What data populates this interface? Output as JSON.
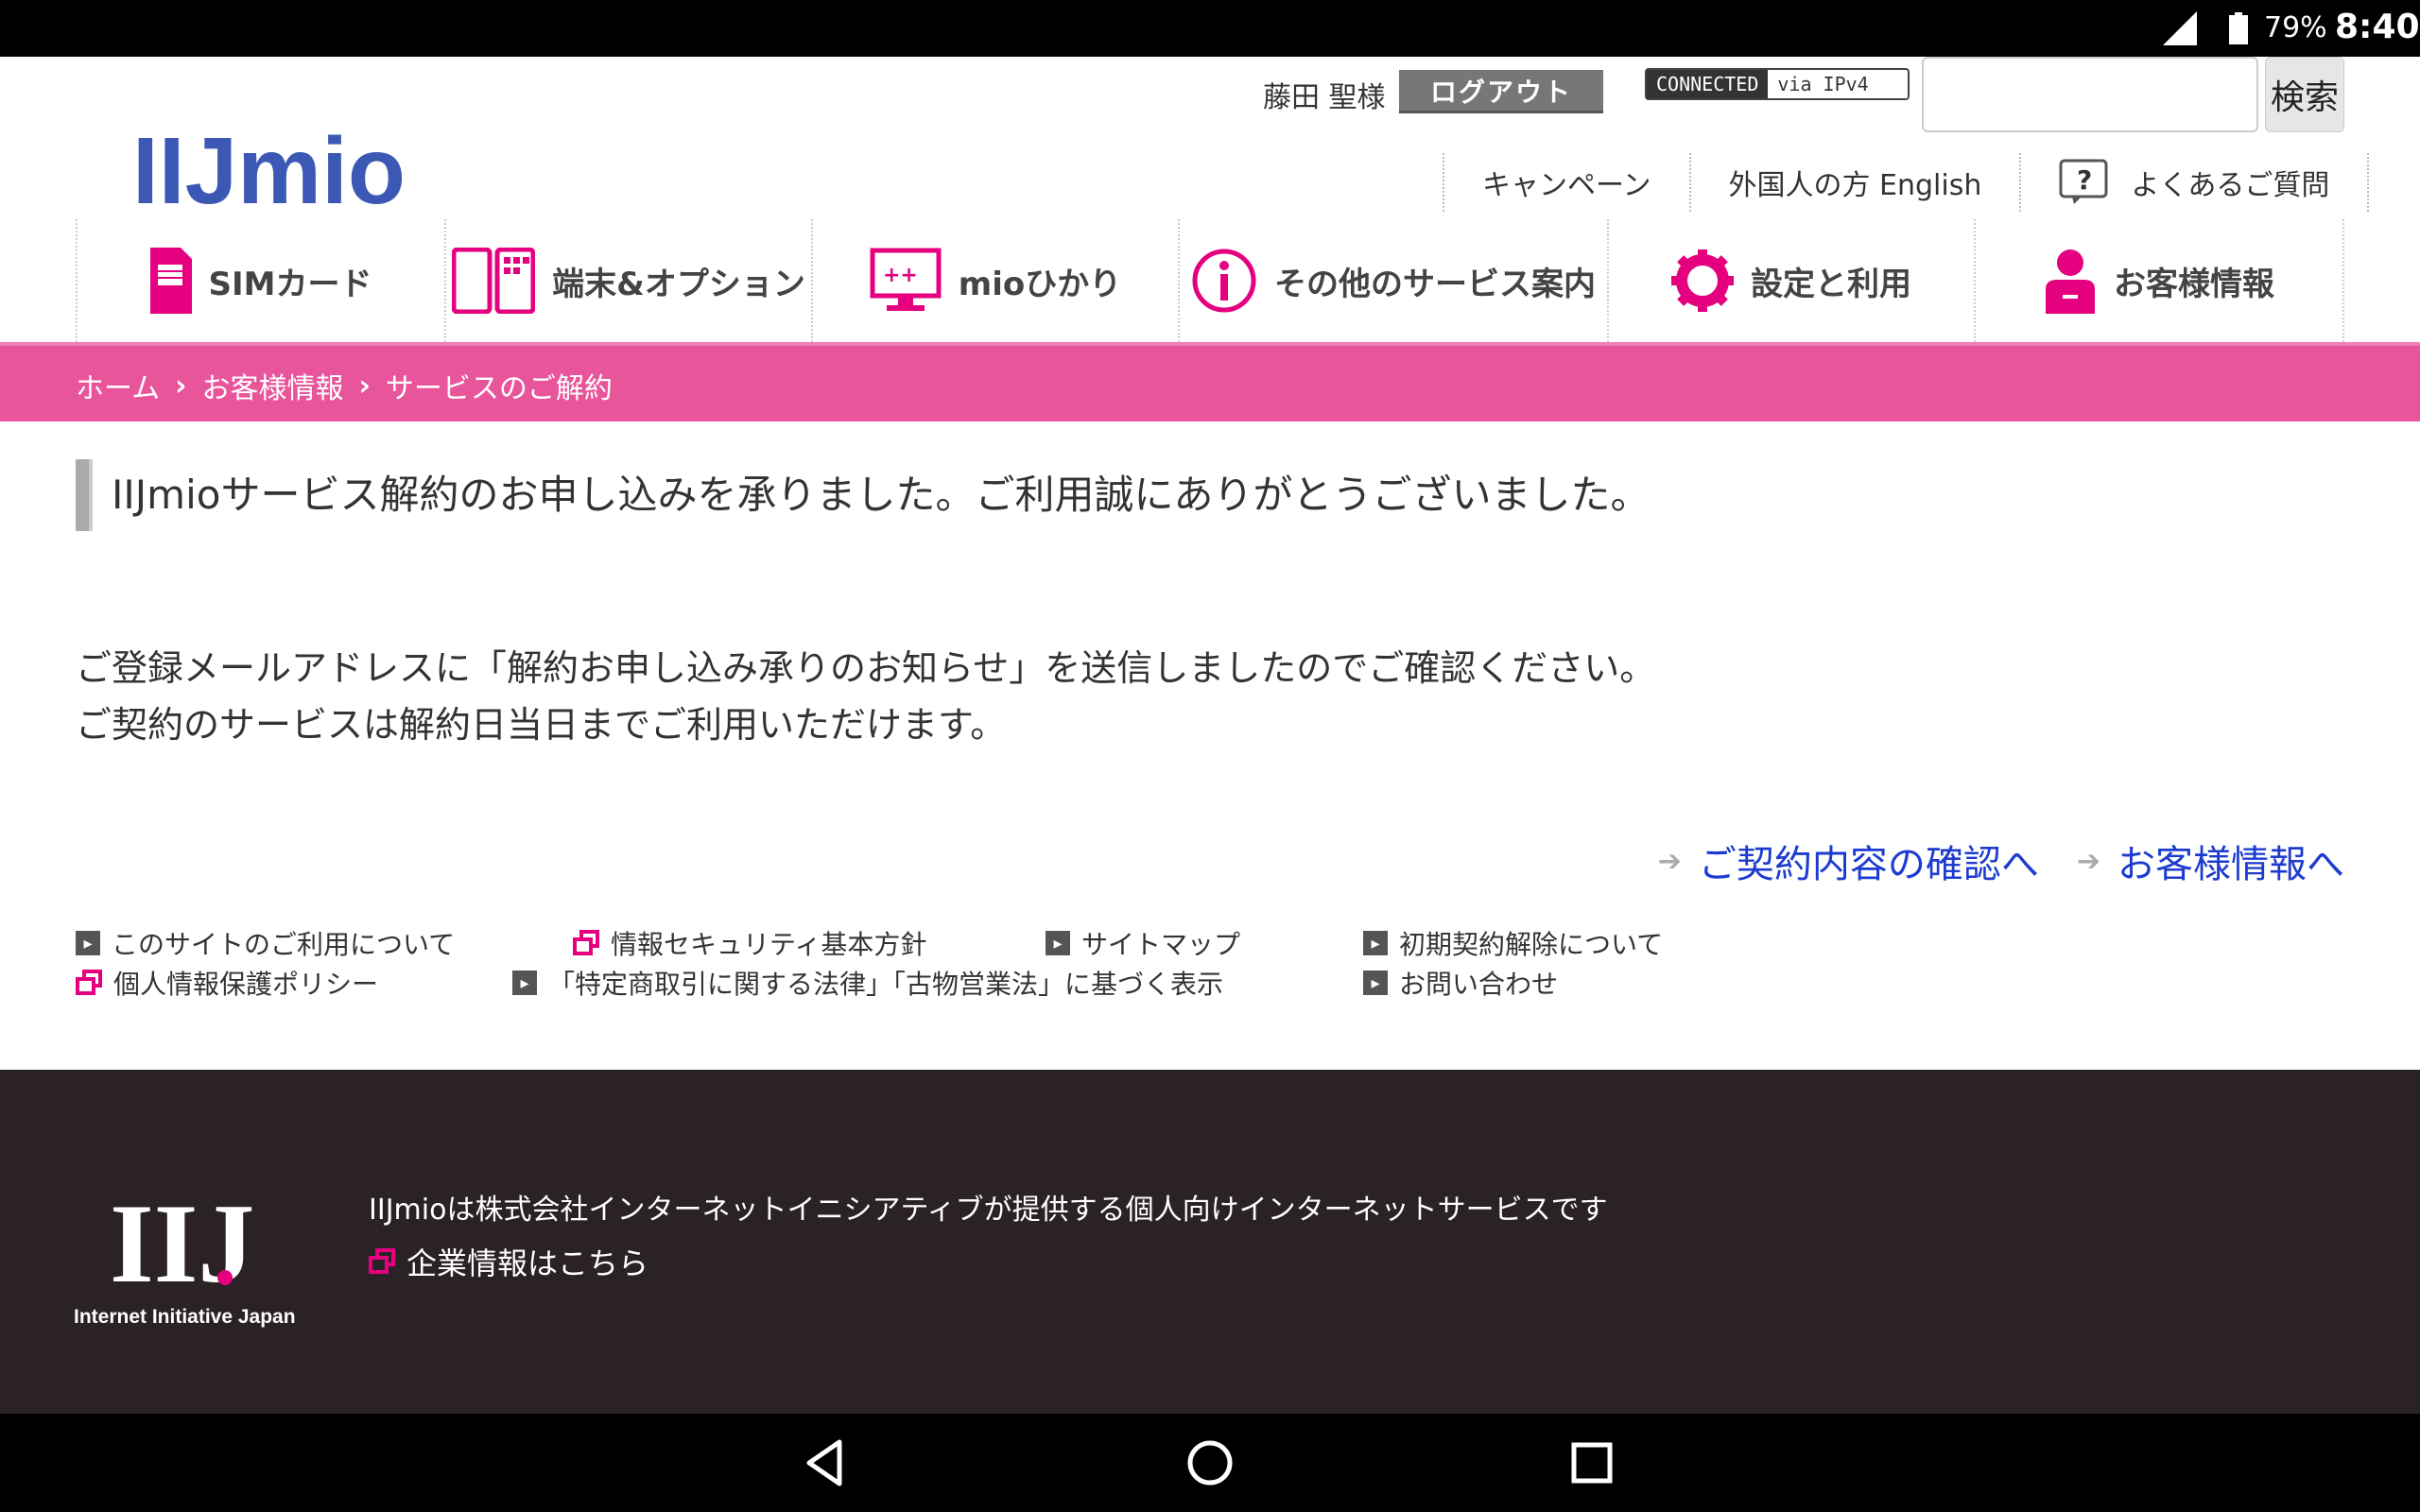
{
  "status_bar": {
    "network": "4G",
    "battery": "79%",
    "time": "8:40"
  },
  "header": {
    "logo_text": "IIJmio",
    "username": "藤田 聖様",
    "logout_label": "ログアウト",
    "connected_label": "CONNECTED",
    "connected_via": "via IPv4",
    "search_placeholder": "",
    "search_button": "検索",
    "top_links": [
      "キャンペーン",
      "外国人の方 English",
      "よくあるご質問"
    ]
  },
  "global_nav": [
    {
      "label": "SIMカード",
      "icon": "sim-card-icon"
    },
    {
      "label": "端末&オプション",
      "icon": "device-icon"
    },
    {
      "label": "mioひかり",
      "icon": "monitor-icon"
    },
    {
      "label": "その他のサービス案内",
      "icon": "info-icon"
    },
    {
      "label": "設定と利用",
      "icon": "gear-icon"
    },
    {
      "label": "お客様情報",
      "icon": "person-icon"
    }
  ],
  "breadcrumb": [
    "ホーム",
    "お客様情報",
    "サービスのご解約"
  ],
  "main": {
    "heading": "IIJmioサービス解約のお申し込みを承りました。ご利用誠にありがとうございました。",
    "para1": "ご登録メールアドレスに「解約お申し込み承りのお知らせ」を送信しましたのでご確認ください。",
    "para2": "ご契約のサービスは解約日当日までご利用いただけます。",
    "link_contract": "ご契約内容の確認へ",
    "link_customer": "お客様情報へ"
  },
  "footer_links": [
    "このサイトのご利用について",
    "情報セキュリティ基本方針",
    "サイトマップ",
    "初期契約解除について",
    "個人情報保護ポリシー",
    "「特定商取引に関する法律」「古物営業法」に基づく表示",
    "お問い合わせ"
  ],
  "footer": {
    "logo_text": "IIJ",
    "logo_caption": "Internet Initiative Japan",
    "description": "IIJmioは株式会社インターネットイニシアティブが提供する個人向けインターネットサービスです",
    "corp_link": "企業情報はこちら"
  },
  "colors": {
    "brand_pink": "#e8559a",
    "brand_blue": "#3b58b5",
    "link_blue": "#1d3ccf",
    "icon_pink": "#e4007f"
  }
}
